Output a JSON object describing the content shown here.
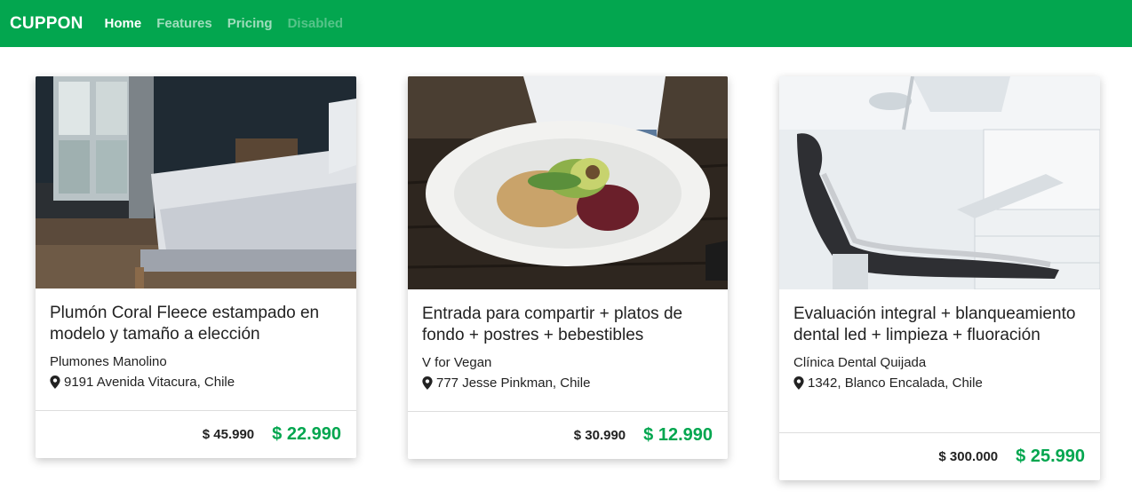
{
  "nav": {
    "brand": "CUPPON",
    "links": [
      "Home",
      "Features",
      "Pricing",
      "Disabled"
    ]
  },
  "cards": [
    {
      "image": "bedroom-bed-photo",
      "title": "Plumón Coral Fleece estampado en modelo y tamaño a elección",
      "seller": "Plumones Manolino",
      "address": "9191 Avenida Vitacura, Chile",
      "old_price": "$ 45.990",
      "new_price": "$ 22.990"
    },
    {
      "image": "salad-plate-photo",
      "title": "Entrada para compartir + platos de fondo + postres + bebestibles",
      "seller": "V for Vegan",
      "address": "777 Jesse Pinkman, Chile",
      "old_price": "$ 30.990",
      "new_price": "$ 12.990"
    },
    {
      "image": "dental-chair-photo",
      "title": "Evaluación integral + blanqueamiento dental led + limpieza + fluoración",
      "seller": "Clínica Dental Quijada",
      "address": "1342, Blanco Encalada, Chile",
      "old_price": "$ 300.000",
      "new_price": "$ 25.990"
    }
  ],
  "colors": {
    "brand_green": "#03a64f",
    "price_green": "#03a64f"
  }
}
